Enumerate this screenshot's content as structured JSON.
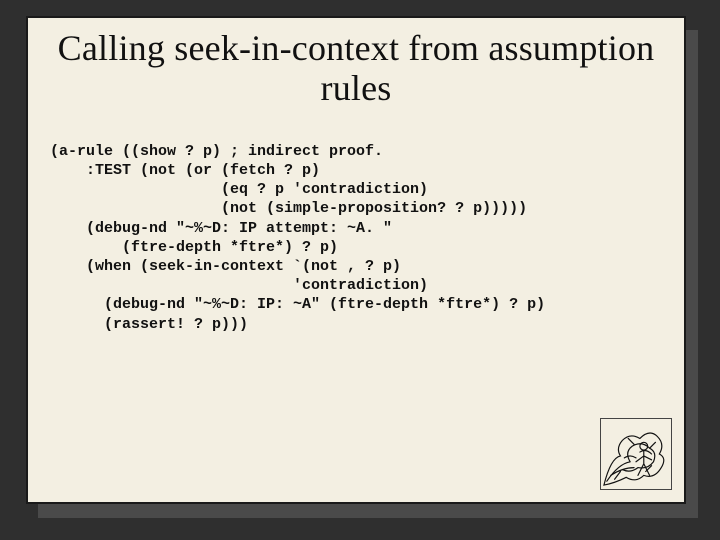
{
  "slide": {
    "title": "Calling seek-in-context from assumption rules",
    "code_lines": [
      "(a-rule ((show ? p) ; indirect proof.",
      "    :TEST (not (or (fetch ? p)",
      "                   (eq ? p 'contradiction)",
      "                   (not (simple-proposition? ? p)))))",
      "    (debug-nd \"~%~D: IP attempt: ~A. \"",
      "        (ftre-depth *ftre*) ? p)",
      "    (when (seek-in-context `(not , ? p)",
      "                           'contradiction)",
      "      (debug-nd \"~%~D: IP: ~A\" (ftre-depth *ftre*) ? p)",
      "      (rassert! ? p)))"
    ],
    "decorative_icon": "scribble-figure"
  }
}
